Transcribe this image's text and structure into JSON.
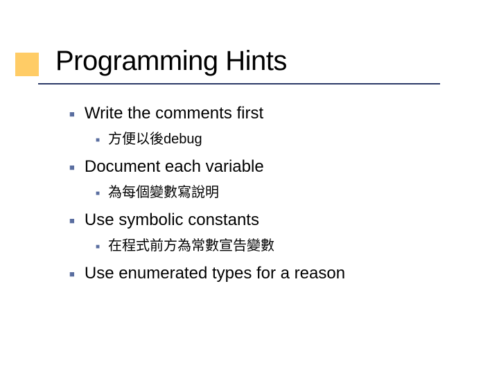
{
  "title": "Programming Hints",
  "items": [
    {
      "text": "Write the comments first",
      "sub": "方便以後debug"
    },
    {
      "text": "Document each variable",
      "sub": "為每個變數寫說明"
    },
    {
      "text": "Use symbolic constants",
      "sub": "在程式前方為常數宣告變數"
    },
    {
      "text": "Use enumerated types for a reason",
      "sub": null
    }
  ]
}
